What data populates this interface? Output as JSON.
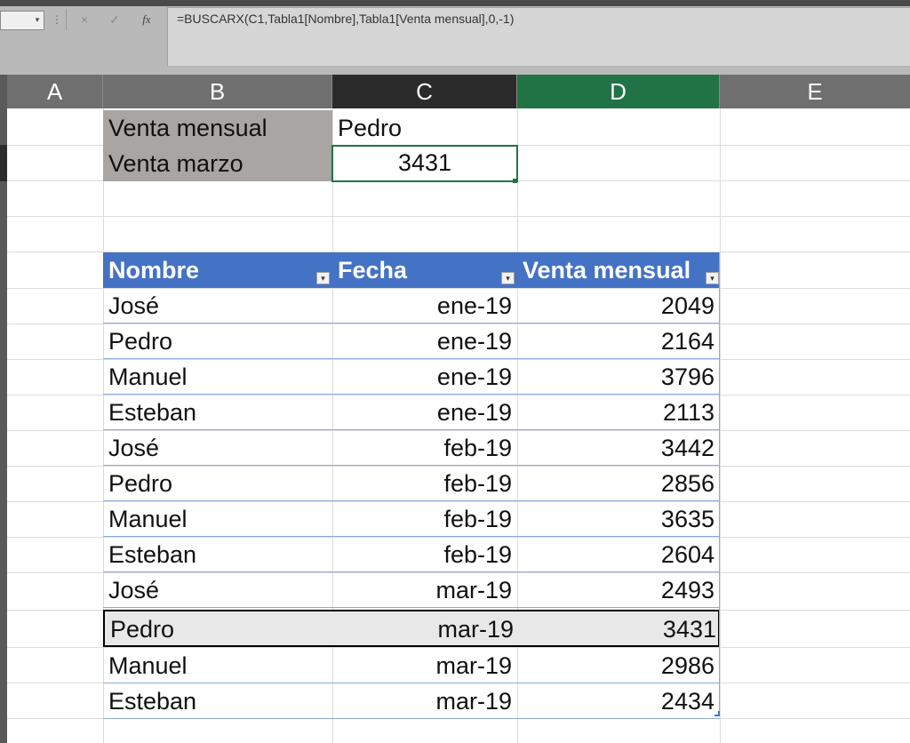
{
  "formula_bar": {
    "name_box": "",
    "formula": "=BUSCARX(C1,Tabla1[Nombre],Tabla1[Venta mensual],0,-1)",
    "cancel_icon": "×",
    "enter_icon": "✓",
    "fx_label": "fx",
    "dots_icon": "⋮",
    "dropdown_icon": "▾"
  },
  "columns": [
    "A",
    "B",
    "C",
    "D",
    "E"
  ],
  "lookup": {
    "label1": "Venta mensual",
    "value1": "Pedro",
    "label2": "Venta marzo",
    "value2": "3431"
  },
  "table": {
    "headers": [
      "Nombre",
      "Fecha",
      "Venta mensual"
    ],
    "filter_icon": "▾",
    "rows": [
      {
        "name": "José",
        "date": "ene-19",
        "sale": "2049"
      },
      {
        "name": "Pedro",
        "date": "ene-19",
        "sale": "2164"
      },
      {
        "name": "Manuel",
        "date": "ene-19",
        "sale": "3796"
      },
      {
        "name": "Esteban",
        "date": "ene-19",
        "sale": "2113"
      },
      {
        "name": "José",
        "date": "feb-19",
        "sale": "3442"
      },
      {
        "name": "Pedro",
        "date": "feb-19",
        "sale": "2856"
      },
      {
        "name": "Manuel",
        "date": "feb-19",
        "sale": "3635"
      },
      {
        "name": "Esteban",
        "date": "feb-19",
        "sale": "2604"
      },
      {
        "name": "José",
        "date": "mar-19",
        "sale": "2493"
      },
      {
        "name": "Pedro",
        "date": "mar-19",
        "sale": "3431"
      },
      {
        "name": "Manuel",
        "date": "mar-19",
        "sale": "2986"
      },
      {
        "name": "Esteban",
        "date": "mar-19",
        "sale": "2434"
      }
    ]
  },
  "colors": {
    "table_header": "#4472c4",
    "active_column": "#217346",
    "selected_column": "#2b2b2b",
    "label_fill": "#a9a5a2"
  }
}
